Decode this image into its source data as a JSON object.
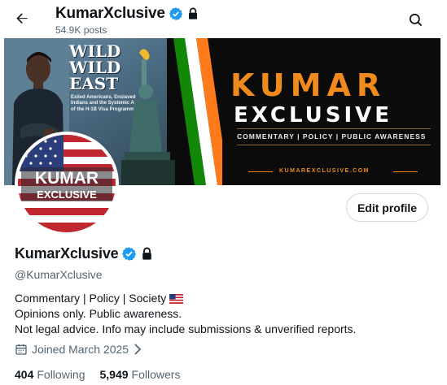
{
  "header": {
    "title": "KumarXclusive",
    "posts_label": "54.9K posts",
    "back_icon": "arrow-left-icon",
    "search_icon": "search-icon"
  },
  "banner": {
    "left_title_line1": "WILD",
    "left_title_line2": "WILD",
    "left_title_line3": "EAST",
    "left_subtitle": "Exiled Americans, Enslaved Indians and the Systemic Abuse of the H-1B Visa Programme",
    "brand_line1": "KUMAR",
    "brand_line2": "EXCLUSIVE",
    "tagline": "COMMENTARY  |  POLICY  |  PUBLIC AWARENESS",
    "url": "KUMAREXCLUSIVE.COM"
  },
  "avatar": {
    "line1": "KUMAR",
    "line2": "EXCLUSIVE"
  },
  "profile": {
    "edit_button": "Edit profile",
    "display_name": "KumarXclusive",
    "handle": "@KumarXclusive",
    "bio_line1": "Commentary | Policy | Society",
    "bio_line2": "Opinions only. Public awareness.",
    "bio_line3": "Not legal advice. Info may include submissions & unverified reports.",
    "joined": "Joined March 2025",
    "following_count": "404",
    "following_label": "Following",
    "followers_count": "5,949",
    "followers_label": "Followers"
  },
  "colors": {
    "verified_blue": "#1d9bf0",
    "brand_orange": "#f08a1c",
    "text_primary": "#0f1419",
    "text_secondary": "#536471"
  }
}
